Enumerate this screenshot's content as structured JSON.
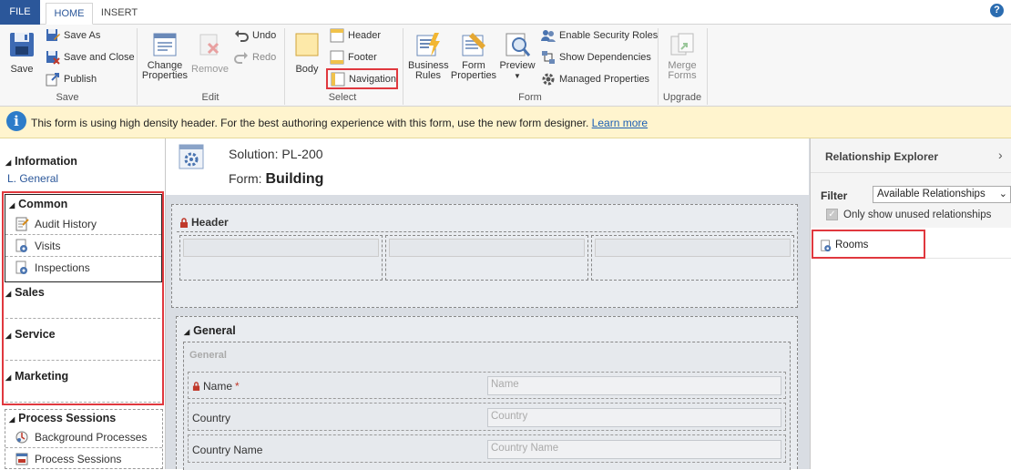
{
  "tabs": {
    "file": "FILE",
    "home": "HOME",
    "insert": "INSERT"
  },
  "help": "?",
  "ribbon": {
    "save_group": {
      "save": "Save",
      "save_as": "Save As",
      "save_close": "Save and Close",
      "publish": "Publish",
      "label": "Save"
    },
    "edit_group": {
      "change_properties": [
        "Change",
        "Properties"
      ],
      "remove": "Remove",
      "undo": "Undo",
      "redo": "Redo",
      "label": "Edit"
    },
    "select_group": {
      "body": "Body",
      "header": "Header",
      "footer": "Footer",
      "navigation": "Navigation",
      "label": "Select"
    },
    "form_group": {
      "business_rules": [
        "Business",
        "Rules"
      ],
      "form_properties": [
        "Form",
        "Properties"
      ],
      "preview": "Preview",
      "enable_security": "Enable Security Roles",
      "show_dependencies": "Show Dependencies",
      "managed_properties": "Managed Properties",
      "label": "Form"
    },
    "upgrade_group": {
      "merge_forms": [
        "Merge",
        "Forms"
      ],
      "label": "Upgrade"
    }
  },
  "banner": {
    "message": "This form is using high density header. For the best authoring experience with this form, use the new form designer.",
    "link": "Learn more"
  },
  "leftnav": {
    "information": "Information",
    "general": "General",
    "common": "Common",
    "common_items": [
      "Audit History",
      "Visits",
      "Inspections"
    ],
    "sales": "Sales",
    "service": "Service",
    "marketing": "Marketing",
    "process_sessions": "Process Sessions",
    "process_items": [
      "Background Processes",
      "Process Sessions"
    ]
  },
  "form_header": {
    "solution_label": "Solution:",
    "solution_value": "PL-200",
    "form_label": "Form:",
    "form_value": "Building"
  },
  "form": {
    "header_section": "Header",
    "general_tab": "General",
    "general_section": "General",
    "fields": [
      {
        "label": "Name",
        "required": "*",
        "placeholder": "Name"
      },
      {
        "label": "Country",
        "placeholder": "Country"
      },
      {
        "label": "Country Name",
        "placeholder": "Country Name"
      }
    ]
  },
  "relationship_explorer": {
    "title": "Relationship Explorer",
    "filter_label": "Filter",
    "filter_value": "Available Relationships",
    "only_unused": "Only show unused relationships",
    "items": [
      "Rooms"
    ]
  },
  "colors": {
    "accent": "#2b579a",
    "highlight": "#e0383e",
    "banner_bg": "#fff4ce"
  }
}
